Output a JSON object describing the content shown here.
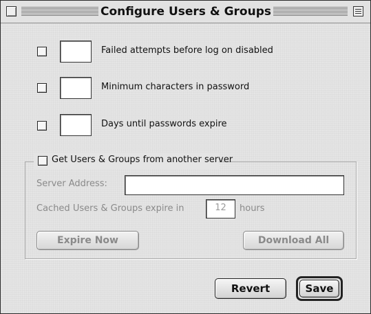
{
  "window": {
    "title": "Configure Users & Groups"
  },
  "rows": [
    {
      "label": "Failed attempts before log on disabled",
      "value": ""
    },
    {
      "label": "Minimum characters in password",
      "value": ""
    },
    {
      "label": "Days until passwords expire",
      "value": ""
    }
  ],
  "server_group": {
    "checkbox_label": "Get Users & Groups from another server",
    "server_address_label": "Server Address:",
    "server_address_value": "",
    "cache_label_before": "Cached Users & Groups expire in",
    "cache_hours": "12",
    "cache_label_after": "hours",
    "expire_now_label": "Expire Now",
    "download_all_label": "Download All"
  },
  "footer": {
    "revert_label": "Revert",
    "save_label": "Save"
  },
  "colors": {
    "window_bg": "#e4e4e4",
    "disabled_text": "#8a8a8a",
    "text": "#111111"
  }
}
